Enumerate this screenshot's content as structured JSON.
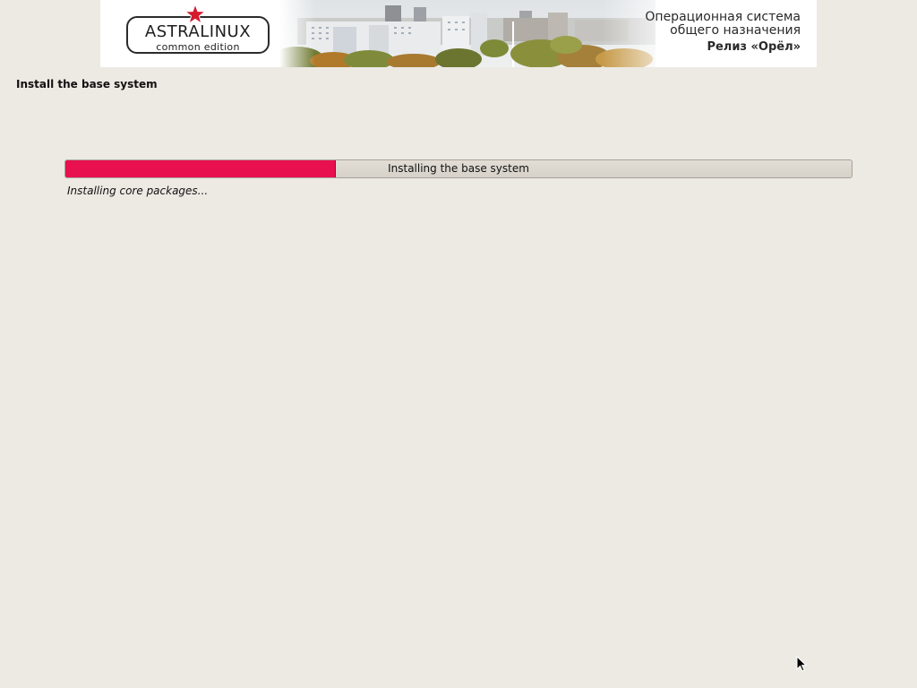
{
  "banner": {
    "logo_main": "ASTRALINUX",
    "logo_sub": "common edition",
    "os_line1": "Операционная система",
    "os_line2": "общего назначения",
    "os_release": "Релиз «Орёл»",
    "accent_star_color": "#d6182f"
  },
  "step": {
    "title": "Install the base system"
  },
  "progress": {
    "label": "Installing the base system",
    "fraction": 0.344,
    "fill_color": "#e8104f"
  },
  "status": {
    "text": "Installing core packages..."
  },
  "icons": {
    "cursor": "mouse-pointer-icon",
    "star": "red-star-icon"
  }
}
